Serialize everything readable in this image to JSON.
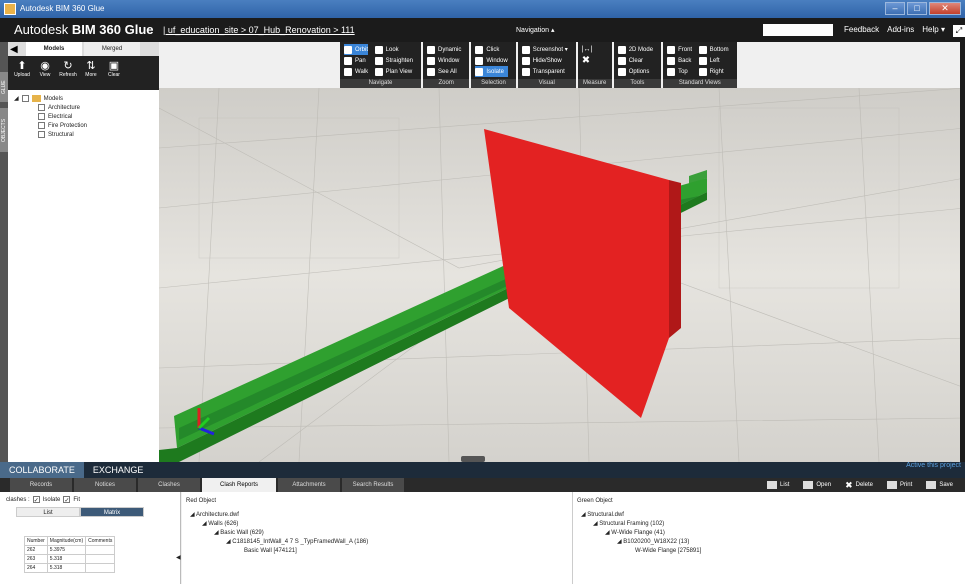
{
  "window": {
    "title": "Autodesk BIM 360 Glue"
  },
  "header": {
    "brand_prefix": "Autodesk",
    "brand_name": "BIM 360",
    "brand_suffix": "Glue",
    "breadcrumb": "| uf_education_site > 07_Hub_Renovation > 111",
    "nav_label": "Navigation ▴",
    "links": [
      "Feedback",
      "Add-ins",
      "Help ▾"
    ]
  },
  "toolbar": {
    "navigate": {
      "label": "Navigate",
      "items": [
        "Orbit",
        "Look",
        "Pan",
        "Straighten",
        "Walk",
        "Plan View"
      ]
    },
    "zoom": {
      "label": "Zoom",
      "items": [
        "Dynamic",
        "Window",
        "See All"
      ]
    },
    "selection": {
      "label": "Selection",
      "items": [
        "Click",
        "Window",
        "Isolate"
      ]
    },
    "visual": {
      "label": "Visual",
      "items": [
        "Screenshot ▾",
        "Hide/Show",
        "Transparent"
      ]
    },
    "measure": {
      "label": "Measure"
    },
    "tools": {
      "label": "Tools",
      "items": [
        "2D Mode",
        "Clear",
        "Options"
      ]
    },
    "standard_views": {
      "label": "Standard Views",
      "items": [
        "Front",
        "Bottom",
        "Back",
        "Left",
        "Top",
        "Right"
      ]
    }
  },
  "left_rail": {
    "tabs": [
      "GLUE",
      "OBJECTS"
    ]
  },
  "left_panel": {
    "tabs": [
      "Models",
      "Merged"
    ],
    "tools": [
      "Upload",
      "View",
      "Refresh",
      "More",
      "Clear"
    ],
    "tree": {
      "root": "Models",
      "children": [
        "Architecture",
        "Electrical",
        "Fire Protection",
        "Structural"
      ]
    }
  },
  "collab_bar": {
    "tabs": [
      "COLLABORATE",
      "EXCHANGE"
    ],
    "project_link": "Active this project"
  },
  "bottom_tabs": [
    "Records",
    "Notices",
    "Clashes",
    "Clash Reports",
    "Attachments",
    "Search Results"
  ],
  "bottom_actions": [
    "List",
    "Open",
    "Delete",
    "Print",
    "Save"
  ],
  "clashes_panel": {
    "label": "clashes :",
    "isolate": "Isolate",
    "fit": "Fit",
    "tabs": [
      "List",
      "Matrix"
    ],
    "columns": [
      "Number",
      "Magnitude(cm)",
      "Comments"
    ],
    "rows": [
      [
        "262",
        "5.3975",
        ""
      ],
      [
        "263",
        "5.318",
        ""
      ],
      [
        "264",
        "5.318",
        ""
      ]
    ]
  },
  "red_object": {
    "title": "Red Object",
    "lines": [
      "◢ Architecture.dwf",
      "◢ Walls (626)",
      "◢ Basic Wall (629)",
      "◢ C1818145_IntWall_4 7 S _TypFramedWall_A (186)",
      "Basic Wall [474121]"
    ]
  },
  "green_object": {
    "title": "Green Object",
    "lines": [
      "◢ Structural.dwf",
      "◢ Structural Framing (102)",
      "◢ W-Wide Flange (41)",
      "◢ B1020200_W18X22 (13)",
      "W-Wide Flange [275891]"
    ]
  }
}
